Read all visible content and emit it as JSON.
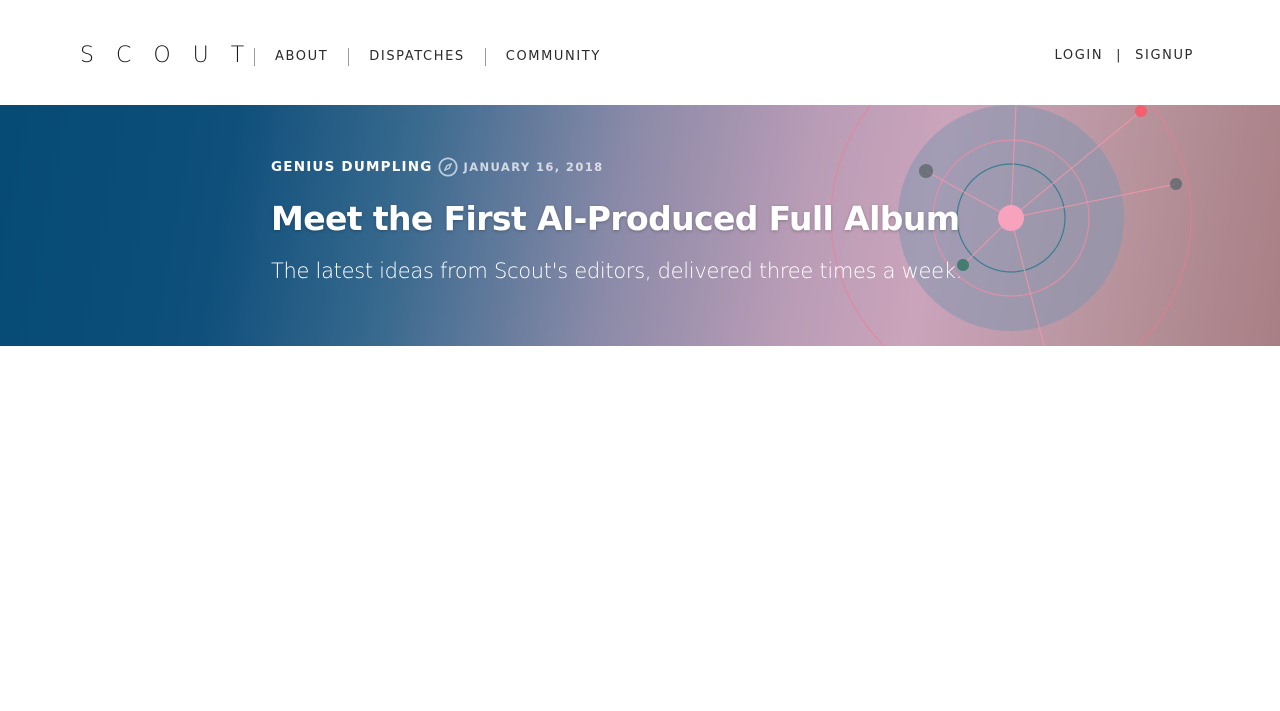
{
  "header": {
    "logo": "SCOUT",
    "nav": [
      {
        "label": "ABOUT"
      },
      {
        "label": "DISPATCHES"
      },
      {
        "label": "COMMUNITY"
      }
    ],
    "auth": {
      "login": "LOGIN",
      "divider": "|",
      "signup": "SIGNUP"
    }
  },
  "hero": {
    "author": "GENIUS DUMPLING",
    "author_icon": "compass-icon",
    "date": "JANUARY 16, 2018",
    "title": "Meet the First AI-Produced Full Album",
    "subtitle": "The latest ideas from Scout's editors, delivered three times a week."
  },
  "colors": {
    "hero_left": "#064a76",
    "hero_mid": "#b99cb6",
    "hero_right": "#a87f84",
    "accent_pink": "#f7a3bd",
    "accent_red": "#f2606e"
  }
}
